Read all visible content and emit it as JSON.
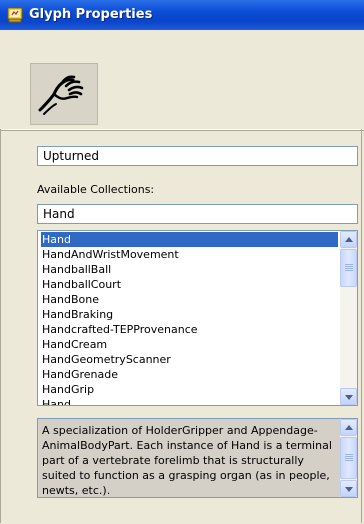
{
  "window": {
    "title": "Glyph Properties"
  },
  "glyph": {
    "name": "Upturned"
  },
  "collections": {
    "label": "Available Collections:",
    "filter_value": "Hand",
    "items": [
      "Hand",
      "HandAndWristMovement",
      "HandballBall",
      "HandballCourt",
      "HandBone",
      "HandBraking",
      "Handcrafted-TEPProvenance",
      "HandCream",
      "HandGeometryScanner",
      "HandGrenade",
      "HandGrip"
    ],
    "selected_index": 0
  },
  "description": {
    "text": "A specialization of HolderGripper and Appendage-AnimalBodyPart. Each instance of Hand is a terminal part of a vertebrate forelimb that is structurally suited to function as a grasping organ (as in people, newts, etc.)."
  },
  "icons": {
    "title_icon": "glyph-properties-icon",
    "glyph_image": "upturned-hand-icon"
  },
  "colors": {
    "titlebar": "#0a4bd6",
    "selection": "#316ac5",
    "field_border": "#7f9db9"
  }
}
